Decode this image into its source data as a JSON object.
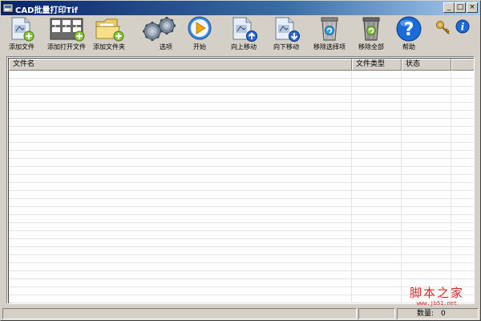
{
  "window": {
    "title": "CAD批量打印Tif",
    "minimize": "_",
    "maximize": "□",
    "close": "×"
  },
  "toolbar": {
    "items": [
      {
        "label": "添加文件",
        "icon": "add-file-icon"
      },
      {
        "label": "添加打开文件",
        "icon": "add-open-file-icon"
      },
      {
        "label": "添加文件夹",
        "icon": "add-folder-icon"
      },
      {
        "label": "选项",
        "icon": "gears-icon"
      },
      {
        "label": "开始",
        "icon": "play-icon"
      },
      {
        "label": "向上移动",
        "icon": "move-up-icon"
      },
      {
        "label": "向下移动",
        "icon": "move-down-icon"
      },
      {
        "label": "移除选择项",
        "icon": "recycle-bin-icon"
      },
      {
        "label": "移除全部",
        "icon": "recycle-bin-all-icon"
      },
      {
        "label": "帮助",
        "icon": "help-icon"
      }
    ]
  },
  "list": {
    "columns": [
      "文件名",
      "文件类型",
      "状态"
    ]
  },
  "status": {
    "count_label": "数量:",
    "count_value": "0"
  },
  "watermark": {
    "title": "脚本之家",
    "url": "www.jb51.net"
  },
  "colors": {
    "title_gradient_start": "#0a246a",
    "title_gradient_end": "#a6caf0",
    "face": "#d4d0c8",
    "watermark": "#d8282a"
  }
}
